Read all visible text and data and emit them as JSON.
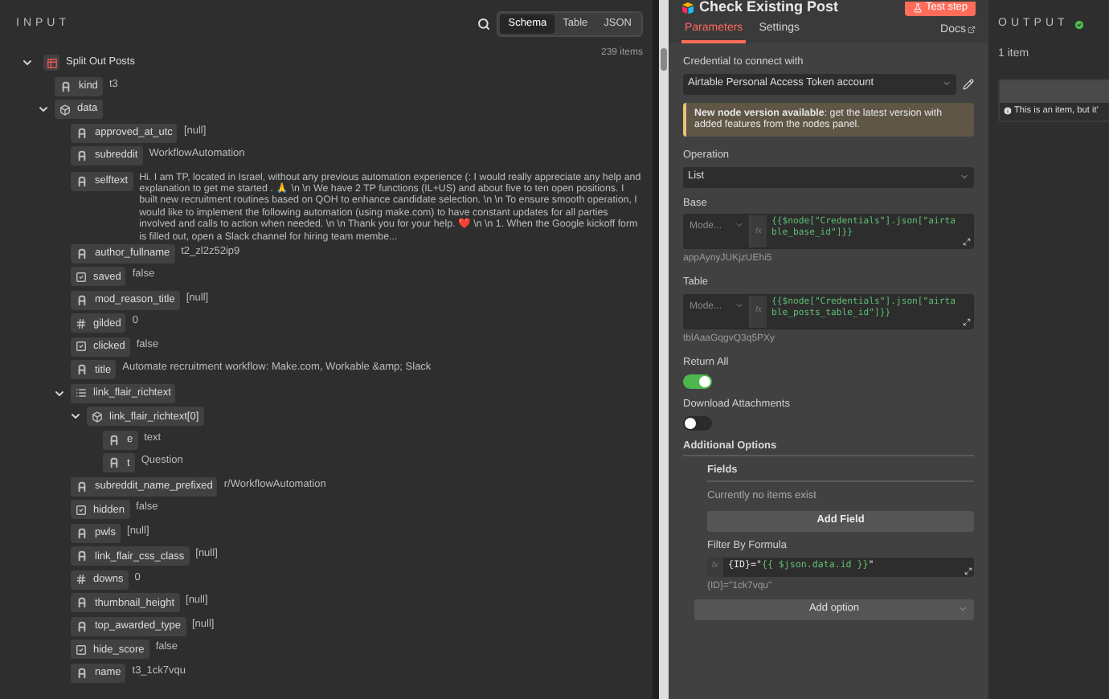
{
  "input": {
    "title": "INPUT",
    "view_tabs": [
      {
        "label": "Schema",
        "selected": true
      },
      {
        "label": "Table",
        "selected": false
      },
      {
        "label": "JSON",
        "selected": false
      }
    ],
    "count": "239 items",
    "tree": [
      {
        "key": "Split Out Posts",
        "kind": "node",
        "expanded": true,
        "children": [
          {
            "key": "kind",
            "kind": "string",
            "value": "t3"
          },
          {
            "key": "data",
            "kind": "object",
            "expanded": true,
            "children": [
              {
                "key": "approved_at_utc",
                "kind": "string",
                "value": "[null]"
              },
              {
                "key": "subreddit",
                "kind": "string",
                "value": "WorkflowAutomation"
              },
              {
                "key": "selftext",
                "kind": "string",
                "value": "Hi. I am TP, located in Israel, without any previous automation experience (: I would really appreciate any help and explanation to get me started . 🙏 \\n \\n We have 2 TP functions (IL+US) and about five to ten open positions. I built new recruitment routines based on QOH to enhance candidate selection. \\n \\n To ensure smooth operation, I would like to implement the following automation (using make.com) to have constant updates for all parties involved and calls to action when needed. \\n \\n Thank you for your help. ❤️ \\n \\n 1. When the Google kickoff form is filled out, open a Slack channel for hiring team membe..."
              },
              {
                "key": "author_fullname",
                "kind": "string",
                "value": "t2_zl2z52ip9"
              },
              {
                "key": "saved",
                "kind": "boolean",
                "value": "false"
              },
              {
                "key": "mod_reason_title",
                "kind": "string",
                "value": "[null]"
              },
              {
                "key": "gilded",
                "kind": "number",
                "value": "0"
              },
              {
                "key": "clicked",
                "kind": "boolean",
                "value": "false"
              },
              {
                "key": "title",
                "kind": "string",
                "value": "Automate recruitment workflow: Make.com, Workable &amp; Slack"
              },
              {
                "key": "link_flair_richtext",
                "kind": "array",
                "expanded": true,
                "children": [
                  {
                    "key": "link_flair_richtext[0]",
                    "kind": "object",
                    "expanded": true,
                    "children": [
                      {
                        "key": "e",
                        "kind": "string",
                        "value": "text"
                      },
                      {
                        "key": "t",
                        "kind": "string",
                        "value": "Question"
                      }
                    ]
                  }
                ]
              },
              {
                "key": "subreddit_name_prefixed",
                "kind": "string",
                "value": "r/WorkflowAutomation"
              },
              {
                "key": "hidden",
                "kind": "boolean",
                "value": "false"
              },
              {
                "key": "pwls",
                "kind": "string",
                "value": "[null]"
              },
              {
                "key": "link_flair_css_class",
                "kind": "string",
                "value": "[null]"
              },
              {
                "key": "downs",
                "kind": "number",
                "value": "0"
              },
              {
                "key": "thumbnail_height",
                "kind": "string",
                "value": "[null]"
              },
              {
                "key": "top_awarded_type",
                "kind": "string",
                "value": "[null]"
              },
              {
                "key": "hide_score",
                "kind": "boolean",
                "value": "false"
              },
              {
                "key": "name",
                "kind": "string",
                "value": "t3_1ck7vqu"
              }
            ]
          }
        ]
      }
    ]
  },
  "node": {
    "title": "Check Existing Post",
    "test_button": "Test step",
    "tabs": [
      {
        "label": "Parameters",
        "selected": true
      },
      {
        "label": "Settings",
        "selected": false
      }
    ],
    "docs": "Docs",
    "credential": {
      "label": "Credential to connect with",
      "value": "Airtable Personal Access Token account"
    },
    "notice": {
      "text": "**New node version available**: get the latest version with added features from the nodes panel."
    },
    "operation": {
      "label": "Operation",
      "value": "List"
    },
    "resources": [
      {
        "label": "Base",
        "mode": "Mode...",
        "expression": "{{$node[\"Credentials\"].json[\"airtable_base_id\"]}}",
        "result": "appAynyJUKjzUEhi5",
        "fx": "fx"
      },
      {
        "label": "Table",
        "mode": "Mode...",
        "expression": "{{$node[\"Credentials\"].json[\"airtable_posts_table_id\"]}}",
        "result": "tblAaaGqgvQ3q5PXy",
        "fx": "fx"
      }
    ],
    "toggles": [
      {
        "label": "Return All",
        "on": true
      },
      {
        "label": "Download Attachments",
        "on": false
      }
    ],
    "additional": {
      "title": "Additional Options",
      "fields_title": "Fields",
      "empty": "Currently no items exist",
      "add_field": "Add Field",
      "formula": {
        "label": "Filter By Formula",
        "fx": "fx",
        "parts": [
          {
            "kind": "plain",
            "text": "{ID}=\""
          },
          {
            "kind": "expression",
            "text": "{{ $json.data.id }}"
          },
          {
            "kind": "plain",
            "text": "\""
          }
        ],
        "result": "{ID}=\"1ck7vqu\""
      },
      "add_option": "Add option"
    }
  },
  "output": {
    "title": "OUTPUT",
    "count": "1 item",
    "hint": "This is an item, but it’"
  }
}
